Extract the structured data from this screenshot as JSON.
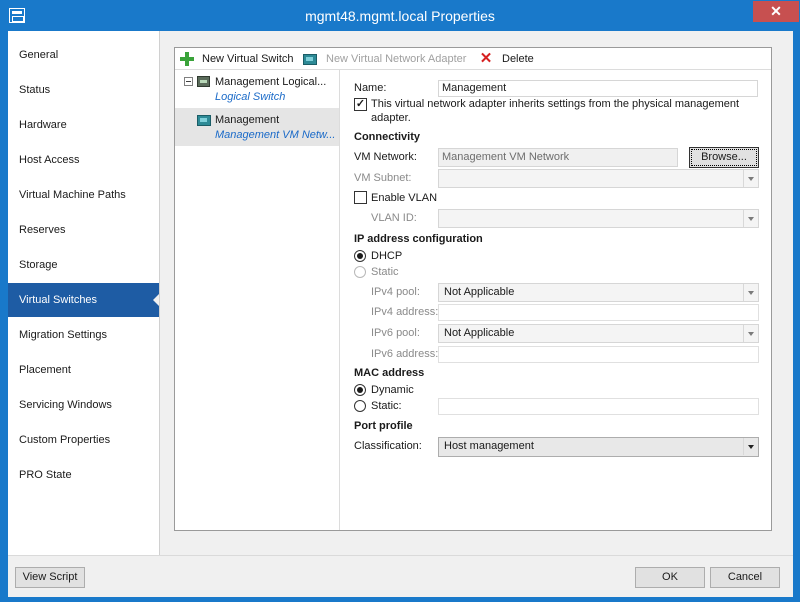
{
  "window": {
    "title": "mgmt48.mgmt.local Properties",
    "close_glyph": "✕"
  },
  "nav": {
    "items": [
      {
        "label": "General"
      },
      {
        "label": "Status"
      },
      {
        "label": "Hardware"
      },
      {
        "label": "Host Access"
      },
      {
        "label": "Virtual Machine Paths"
      },
      {
        "label": "Reserves"
      },
      {
        "label": "Storage"
      },
      {
        "label": "Virtual Switches",
        "selected": true
      },
      {
        "label": "Migration Settings"
      },
      {
        "label": "Placement"
      },
      {
        "label": "Servicing Windows"
      },
      {
        "label": "Custom Properties"
      },
      {
        "label": "PRO State"
      }
    ]
  },
  "toolbar": {
    "new_switch": "New Virtual Switch",
    "new_adapter": "New Virtual Network Adapter",
    "delete": "Delete",
    "delete_glyph": "✕"
  },
  "tree": {
    "switch_title": "Management Logical...",
    "switch_subtitle": "Logical Switch",
    "adapter_title": "Management",
    "adapter_subtitle": "Management VM Netw..."
  },
  "form": {
    "name_label": "Name:",
    "name_value": "Management",
    "inherit_text_line1": "This virtual network adapter inherits settings from the physical management",
    "inherit_text_line2": "adapter.",
    "inherit_checked": "✓",
    "connectivity_heading": "Connectivity",
    "vm_network_label": "VM Network:",
    "vm_network_value": "Management VM Network",
    "browse_label": "Browse...",
    "vm_subnet_label": "VM Subnet:",
    "enable_vlan_label": "Enable VLAN",
    "vlan_id_label": "VLAN ID:",
    "ip_heading": "IP address configuration",
    "dhcp_label": "DHCP",
    "static_ip_label": "Static",
    "ipv4_pool_label": "IPv4 pool:",
    "ipv4_pool_value": "Not Applicable",
    "ipv4_address_label": "IPv4 address:",
    "ipv6_pool_label": "IPv6 pool:",
    "ipv6_pool_value": "Not Applicable",
    "ipv6_address_label": "IPv6 address:",
    "mac_heading": "MAC address",
    "dynamic_label": "Dynamic",
    "static_mac_label": "Static:",
    "port_heading": "Port profile",
    "classification_label": "Classification:",
    "classification_value": "Host management"
  },
  "footer": {
    "view_script": "View Script",
    "ok": "OK",
    "cancel": "Cancel"
  }
}
